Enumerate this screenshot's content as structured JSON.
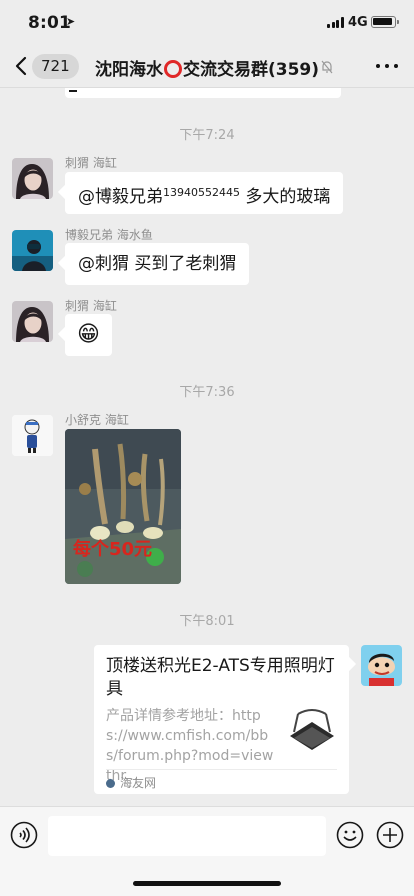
{
  "status_bar": {
    "time": "8:01",
    "network": "4G"
  },
  "nav": {
    "unread_count": "721",
    "title_before": "沈阳海水",
    "title_after": "交流交易群(359)"
  },
  "messages": [
    {
      "type": "timestamp",
      "text": "下午7:24"
    },
    {
      "type": "text",
      "sender": "刺猬 海缸",
      "text_before": "@博毅兄弟",
      "text_sup": "13940552445",
      "text_after": " 多大的玻璃"
    },
    {
      "type": "text",
      "sender": "博毅兄弟 海水鱼",
      "text": "@刺猬 买到了老刺猬"
    },
    {
      "type": "emoji",
      "sender": "刺猬 海缸",
      "emoji": "😁"
    },
    {
      "type": "timestamp",
      "text": "下午7:36"
    },
    {
      "type": "image",
      "sender": "小舒克 海缸",
      "overlay_text": "每个50元"
    },
    {
      "type": "timestamp",
      "text": "下午8:01"
    },
    {
      "type": "link_card",
      "title": "顶楼送积光E2-ATS专用照明灯具",
      "description": "产品详情参考地址：https://www.cmfish.com/bbs/forum.php?mod=viewthr...",
      "source": "海友网"
    }
  ],
  "icons": [
    "back-chevron-icon",
    "mute-bell-icon",
    "more-icon",
    "location-arrow-icon",
    "voice-icon",
    "emoji-icon",
    "plus-icon"
  ],
  "colors": {
    "background": "#ededed",
    "bubble": "#ffffff",
    "timestamp": "#a8a8a8",
    "title_ring": "#e02828"
  }
}
